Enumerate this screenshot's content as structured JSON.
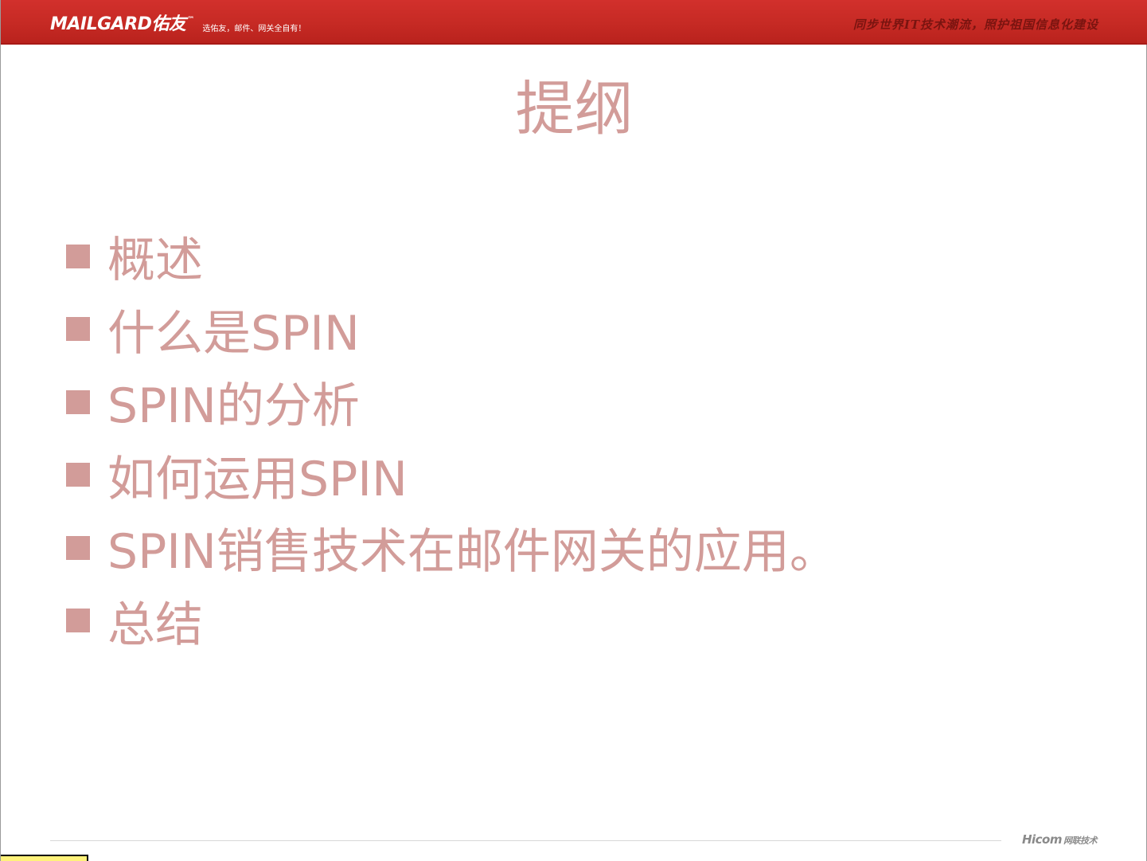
{
  "header": {
    "logo_text": "MAILGARD佑友",
    "logo_tm": "™",
    "tagline": "选佑友，邮件、网关全自有！",
    "slogan": "同步世界IT技术潮流，照护祖国信息化建设"
  },
  "slide": {
    "title": "提纲",
    "bullets": [
      "概述",
      "什么是SPIN",
      "SPIN的分析",
      "如何运用SPIN",
      "SPIN销售技术在邮件网关的应用。",
      "总结"
    ]
  },
  "footer": {
    "logo_main": "Hicom",
    "logo_sub": "网联技术"
  },
  "colors": {
    "header_red": "#c62a24",
    "text_pink": "#d29c99"
  }
}
